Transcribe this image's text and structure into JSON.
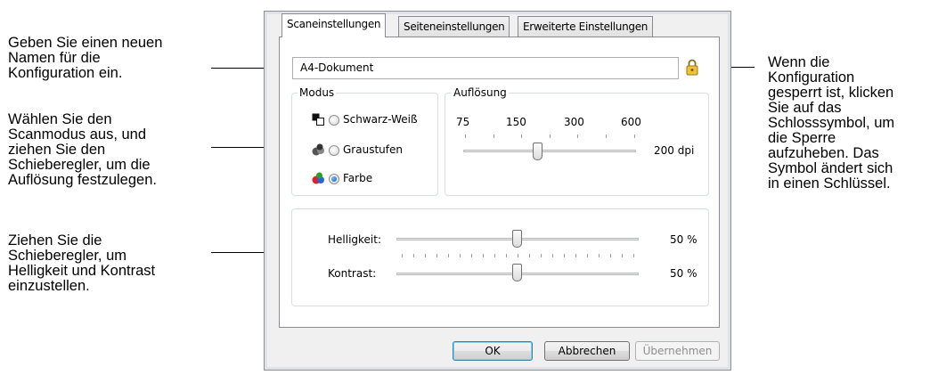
{
  "callouts": {
    "left1": [
      "Geben Sie einen neuen",
      "Namen für die",
      "Konfiguration ein."
    ],
    "left2": [
      "Wählen Sie den",
      "Scanmodus aus, und",
      "ziehen Sie den",
      "Schieberegler, um die",
      "Auflösung festzulegen."
    ],
    "left3": [
      "Ziehen Sie die",
      "Schieberegler, um",
      "Helligkeit und Kontrast",
      "einzustellen."
    ],
    "right": [
      "Wenn die",
      "Konfiguration",
      "gesperrt ist, klicken",
      "Sie auf das",
      "Schlosssymbol, um",
      "die Sperre",
      "aufzuheben. Das",
      "Symbol ändert sich",
      "in einen Schlüssel."
    ]
  },
  "tabs": [
    "Scaneinstellungen",
    "Seiteneinstellungen",
    "Erweiterte Einstellungen"
  ],
  "name_field": {
    "value": "A4-Dokument"
  },
  "mode": {
    "label": "Modus",
    "options": [
      "Schwarz-Weiß",
      "Graustufen",
      "Farbe"
    ],
    "selected": "Farbe"
  },
  "resolution": {
    "label": "Auflösung",
    "ticks": [
      "75",
      "150",
      "300",
      "600"
    ],
    "value_text": "200 dpi",
    "value": 200
  },
  "brightness": {
    "label": "Helligkeit:",
    "value_text": "50 %",
    "value": 50
  },
  "contrast": {
    "label": "Kontrast:",
    "value_text": "50 %",
    "value": 50
  },
  "buttons": {
    "ok": "OK",
    "cancel": "Abbrechen",
    "apply": "Übernehmen"
  },
  "icons": {
    "lock": "lock-icon"
  }
}
